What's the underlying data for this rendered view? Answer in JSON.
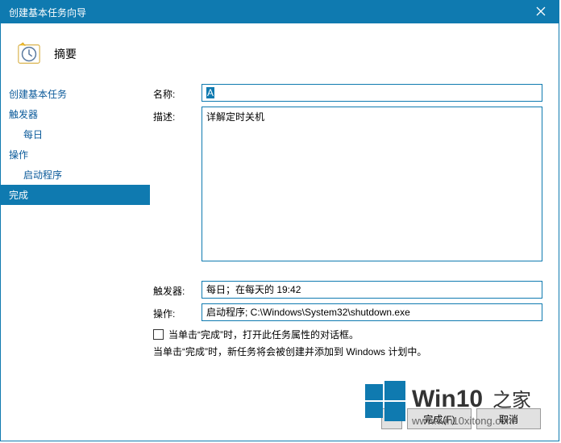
{
  "titlebar": {
    "title": "创建基本任务向导"
  },
  "header": {
    "title": "摘要"
  },
  "sidebar": {
    "items": [
      {
        "label": "创建基本任务",
        "sub": false,
        "active": false
      },
      {
        "label": "触发器",
        "sub": false,
        "active": false
      },
      {
        "label": "每日",
        "sub": true,
        "active": false
      },
      {
        "label": "操作",
        "sub": false,
        "active": false
      },
      {
        "label": "启动程序",
        "sub": true,
        "active": false
      },
      {
        "label": "完成",
        "sub": false,
        "active": true
      }
    ]
  },
  "form": {
    "name_label": "名称:",
    "name_value": "A",
    "desc_label": "描述:",
    "desc_value": "详解定时关机",
    "trigger_label": "触发器:",
    "trigger_value": "每日；在每天的 19:42",
    "action_label": "操作:",
    "action_value": "启动程序; C:\\Windows\\System32\\shutdown.exe",
    "open_props_label": "当单击“完成”时，打开此任务属性的对话框。",
    "hint": "当单击“完成”时，新任务将会被创建并添加到 Windows 计划中。"
  },
  "footer": {
    "back_label": "<",
    "finish_label": "完成(F)",
    "cancel_label": "取消"
  },
  "watermark": {
    "brand": "Win10",
    "suffix": "之家",
    "url": "www.win10xitong.com"
  }
}
